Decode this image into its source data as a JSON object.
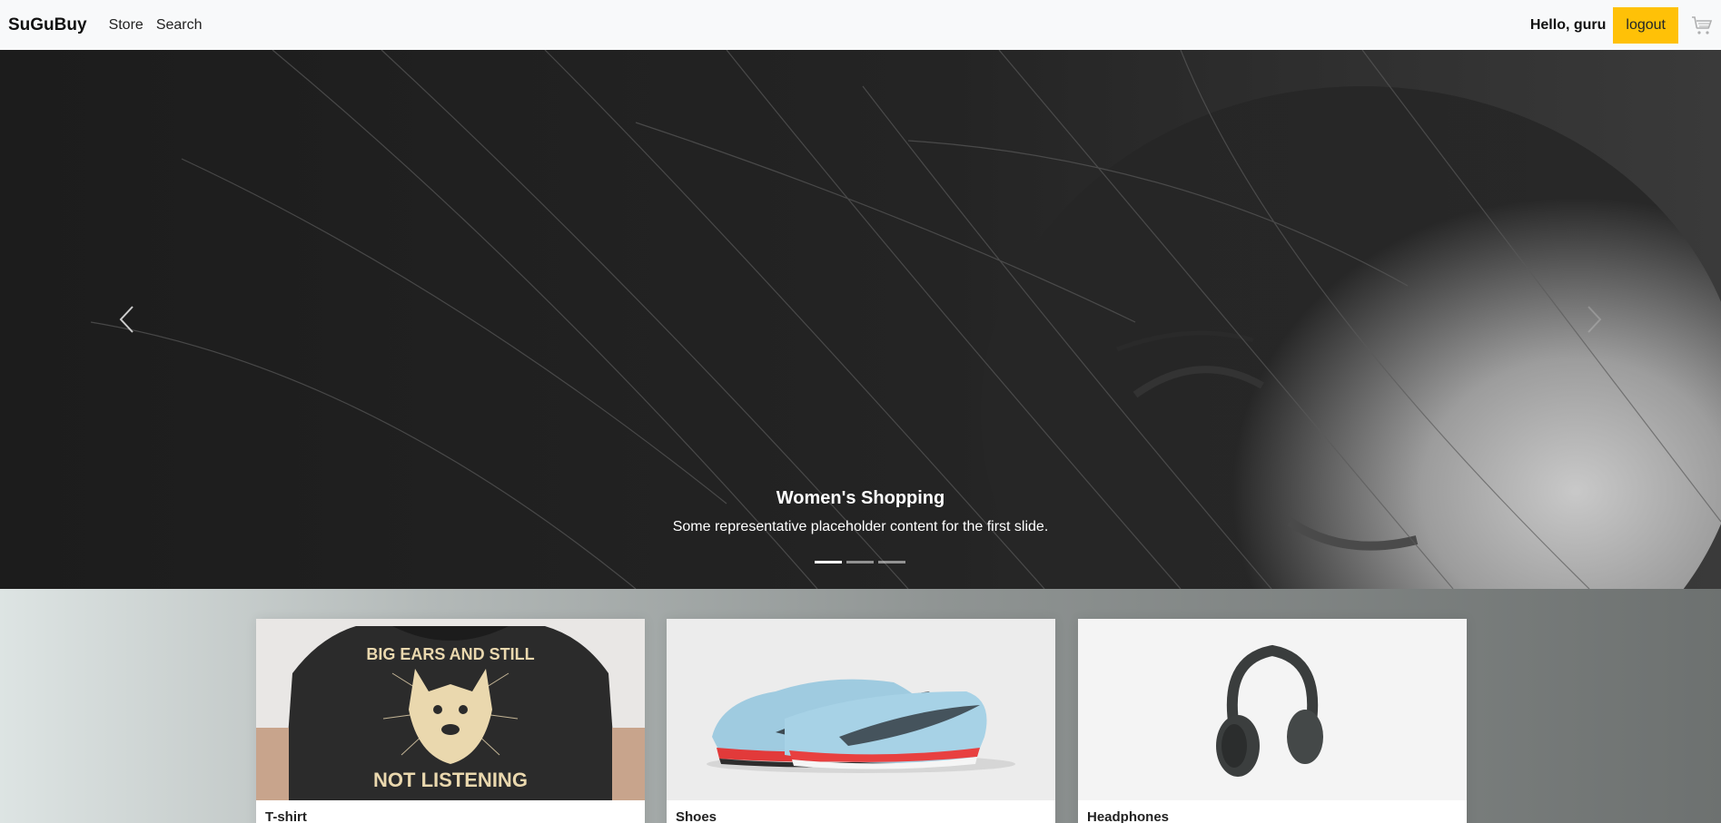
{
  "navbar": {
    "brand": "SuGuBuy",
    "links": [
      "Store",
      "Search"
    ],
    "greeting": "Hello, guru",
    "logout_label": "logout",
    "cart_icon": "shopping-cart-icon"
  },
  "carousel": {
    "slide_title": "Women's Shopping",
    "slide_text": "Some representative placeholder content for the first slide.",
    "indicator_count": 3,
    "active_indicator": 1,
    "prev_icon": "chevron-left-icon",
    "next_icon": "chevron-right-icon"
  },
  "products": [
    {
      "title": "T-shirt",
      "image_text_top": "BIG EARS AND STILL",
      "image_text_bottom": "NOT LISTENING"
    },
    {
      "title": "Shoes"
    },
    {
      "title": "Headphones"
    }
  ],
  "colors": {
    "logout_bg": "#ffc107",
    "navbar_bg": "#f8f9fa"
  }
}
